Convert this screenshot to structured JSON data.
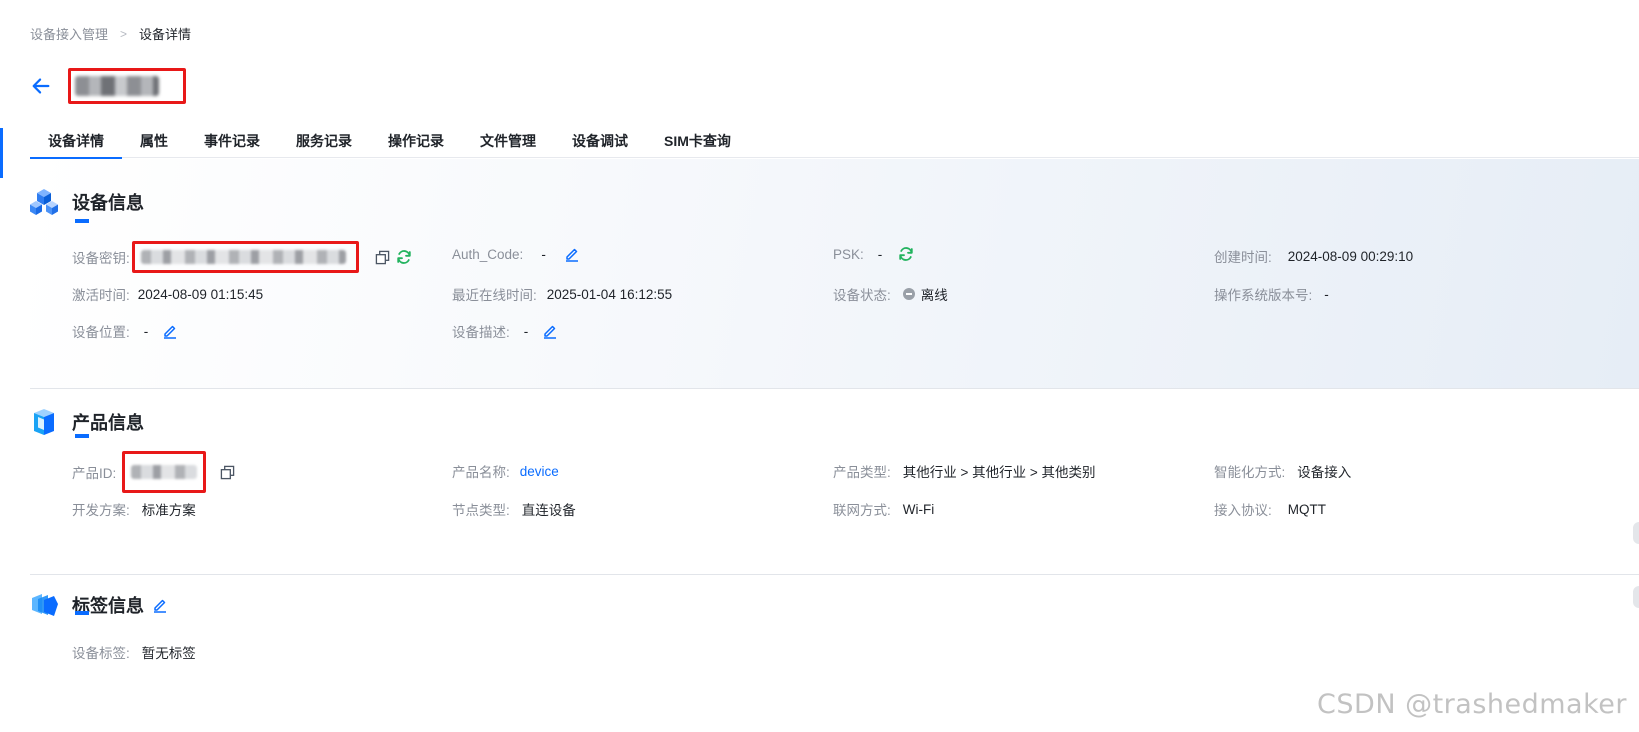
{
  "breadcrumb": {
    "parent": "设备接入管理",
    "separator": ">",
    "current": "设备详情"
  },
  "tabs": [
    {
      "label": "设备详情",
      "active": true
    },
    {
      "label": "属性"
    },
    {
      "label": "事件记录"
    },
    {
      "label": "服务记录"
    },
    {
      "label": "操作记录"
    },
    {
      "label": "文件管理"
    },
    {
      "label": "设备调试"
    },
    {
      "label": "SIM卡查询"
    }
  ],
  "device_info": {
    "title": "设备信息",
    "secret": {
      "label": "设备密钥:"
    },
    "auth_code": {
      "label": "Auth_Code:",
      "value": "-"
    },
    "psk": {
      "label": "PSK:",
      "value": "-"
    },
    "created": {
      "label": "创建时间:",
      "value": "2024-08-09 00:29:10"
    },
    "activated": {
      "label": "激活时间:",
      "value": "2024-08-09 01:15:45"
    },
    "last_online": {
      "label": "最近在线时间:",
      "value": "2025-01-04 16:12:55"
    },
    "status": {
      "label": "设备状态:",
      "value": "离线"
    },
    "os_version": {
      "label": "操作系统版本号:",
      "value": "-"
    },
    "location": {
      "label": "设备位置:",
      "value": "-"
    },
    "description": {
      "label": "设备描述:",
      "value": "-"
    }
  },
  "product_info": {
    "title": "产品信息",
    "product_id": {
      "label": "产品ID:"
    },
    "product_name": {
      "label": "产品名称:",
      "value": "device"
    },
    "product_type": {
      "label": "产品类型:",
      "value": "其他行业 > 其他行业 > 其他类别"
    },
    "smart_mode": {
      "label": "智能化方式:",
      "value": "设备接入"
    },
    "dev_plan": {
      "label": "开发方案:",
      "value": "标准方案"
    },
    "node_type": {
      "label": "节点类型:",
      "value": "直连设备"
    },
    "network": {
      "label": "联网方式:",
      "value": "Wi-Fi"
    },
    "protocol": {
      "label": "接入协议:",
      "value": "MQTT"
    }
  },
  "tag_info": {
    "title": "标签信息",
    "device_tags": {
      "label": "设备标签:",
      "value": "暂无标签"
    }
  },
  "watermark": "CSDN @trashedmaker",
  "colors": {
    "accent": "#0a6cff",
    "highlight_box": "#e81818",
    "refresh": "#22b35e",
    "offline": "#9aa0a8"
  }
}
